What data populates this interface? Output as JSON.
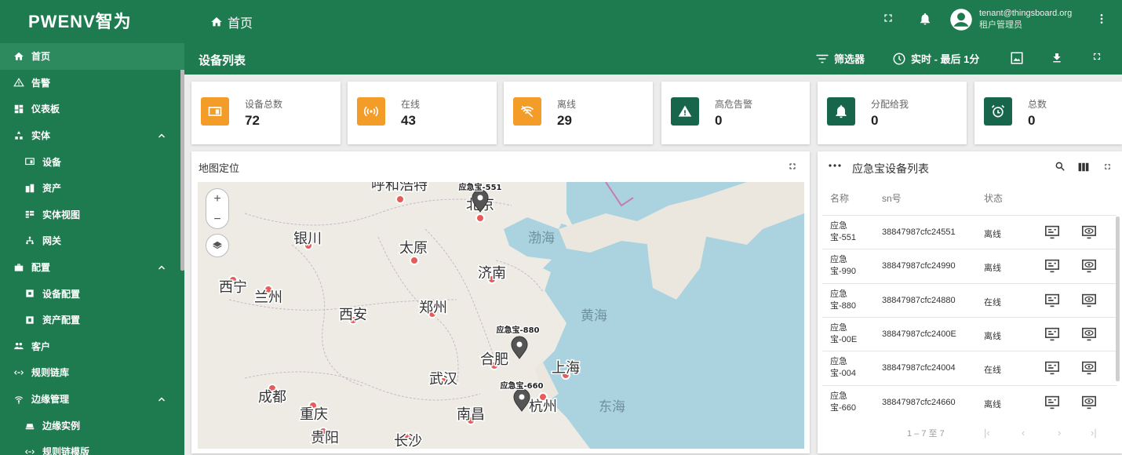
{
  "app": {
    "logo_text": "PWENV智为",
    "home_label": "首页",
    "user_email": "tenant@thingsboard.org",
    "user_role": "租户管理员"
  },
  "sidebar": {
    "items": [
      {
        "label": "首页",
        "icon": "home-icon",
        "active": true,
        "sub": false,
        "chevron": false
      },
      {
        "label": "告警",
        "icon": "warning-icon",
        "active": false,
        "sub": false,
        "chevron": false
      },
      {
        "label": "仪表板",
        "icon": "dashboard-icon",
        "active": false,
        "sub": false,
        "chevron": false
      },
      {
        "label": "实体",
        "icon": "entity-icon",
        "active": false,
        "sub": false,
        "chevron": true
      },
      {
        "label": "设备",
        "icon": "device-icon",
        "active": false,
        "sub": true,
        "chevron": false
      },
      {
        "label": "资产",
        "icon": "asset-icon",
        "active": false,
        "sub": true,
        "chevron": false
      },
      {
        "label": "实体视图",
        "icon": "entity-view-icon",
        "active": false,
        "sub": true,
        "chevron": false
      },
      {
        "label": "网关",
        "icon": "gateway-icon",
        "active": false,
        "sub": true,
        "chevron": false
      },
      {
        "label": "配置",
        "icon": "config-icon",
        "active": false,
        "sub": false,
        "chevron": true
      },
      {
        "label": "设备配置",
        "icon": "device-profile-icon",
        "active": false,
        "sub": true,
        "chevron": false
      },
      {
        "label": "资产配置",
        "icon": "asset-profile-icon",
        "active": false,
        "sub": true,
        "chevron": false
      },
      {
        "label": "客户",
        "icon": "customers-icon",
        "active": false,
        "sub": false,
        "chevron": false
      },
      {
        "label": "规则链库",
        "icon": "rule-chain-icon",
        "active": false,
        "sub": false,
        "chevron": false
      },
      {
        "label": "边缘管理",
        "icon": "edge-icon",
        "active": false,
        "sub": false,
        "chevron": true
      },
      {
        "label": "边缘实例",
        "icon": "edge-instance-icon",
        "active": false,
        "sub": true,
        "chevron": false
      },
      {
        "label": "规则链模版",
        "icon": "rule-chain-template-icon",
        "active": false,
        "sub": true,
        "chevron": false
      }
    ]
  },
  "toolbar": {
    "title": "设备列表",
    "filter_label": "筛选器",
    "time_label": "实时 - 最后 1分"
  },
  "cards": [
    {
      "label": "设备总数",
      "value": "72",
      "color": "#f39c27",
      "icon": "device-icon"
    },
    {
      "label": "在线",
      "value": "43",
      "color": "#f39c27",
      "icon": "signal-icon"
    },
    {
      "label": "离线",
      "value": "29",
      "color": "#f39c27",
      "icon": "wifi-off-icon"
    },
    {
      "label": "高危告警",
      "value": "0",
      "color": "#17654a",
      "icon": "alert-icon"
    },
    {
      "label": "分配给我",
      "value": "0",
      "color": "#17654a",
      "icon": "bell-icon"
    },
    {
      "label": "总数",
      "value": "0",
      "color": "#17654a",
      "icon": "alarm-clock-icon"
    }
  ],
  "map": {
    "title": "地图定位",
    "cities": [
      {
        "name": "呼和浩特"
      },
      {
        "name": "北京"
      },
      {
        "name": "银川"
      },
      {
        "name": "太原"
      },
      {
        "name": "济南"
      },
      {
        "name": "西宁"
      },
      {
        "name": "兰州"
      },
      {
        "name": "西安"
      },
      {
        "name": "郑州"
      },
      {
        "name": "合肥"
      },
      {
        "name": "武汉"
      },
      {
        "name": "上海"
      },
      {
        "name": "成都"
      },
      {
        "name": "重庆"
      },
      {
        "name": "南昌"
      },
      {
        "name": "杭州"
      },
      {
        "name": "贵阳"
      },
      {
        "name": "长沙"
      }
    ],
    "seas": [
      "渤海",
      "黄海",
      "东海"
    ],
    "markers": [
      {
        "label": "应急宝-551"
      },
      {
        "label": "应急宝-880"
      },
      {
        "label": "应急宝-660"
      }
    ]
  },
  "device_table": {
    "title": "应急宝设备列表",
    "headers": {
      "name": "名称",
      "sn": "sn号",
      "status": "状态"
    },
    "rows": [
      {
        "name": "应急宝-551",
        "sn": "38847987cfc24551",
        "status": "离线"
      },
      {
        "name": "应急宝-990",
        "sn": "38847987cfc24990",
        "status": "离线"
      },
      {
        "name": "应急宝-880",
        "sn": "38847987cfc24880",
        "status": "在线"
      },
      {
        "name": "应急宝-00E",
        "sn": "38847987cfc2400E",
        "status": "离线"
      },
      {
        "name": "应急宝-004",
        "sn": "38847987cfc24004",
        "status": "在线"
      },
      {
        "name": "应急宝-660",
        "sn": "38847987cfc24660",
        "status": "离线"
      }
    ],
    "pager_text": "1 – 7 至 7"
  },
  "colors": {
    "brand_green": "#1e7b4f",
    "tile_orange": "#f39c27",
    "tile_dark_green": "#17654a",
    "sea_blue": "#aad3df"
  }
}
